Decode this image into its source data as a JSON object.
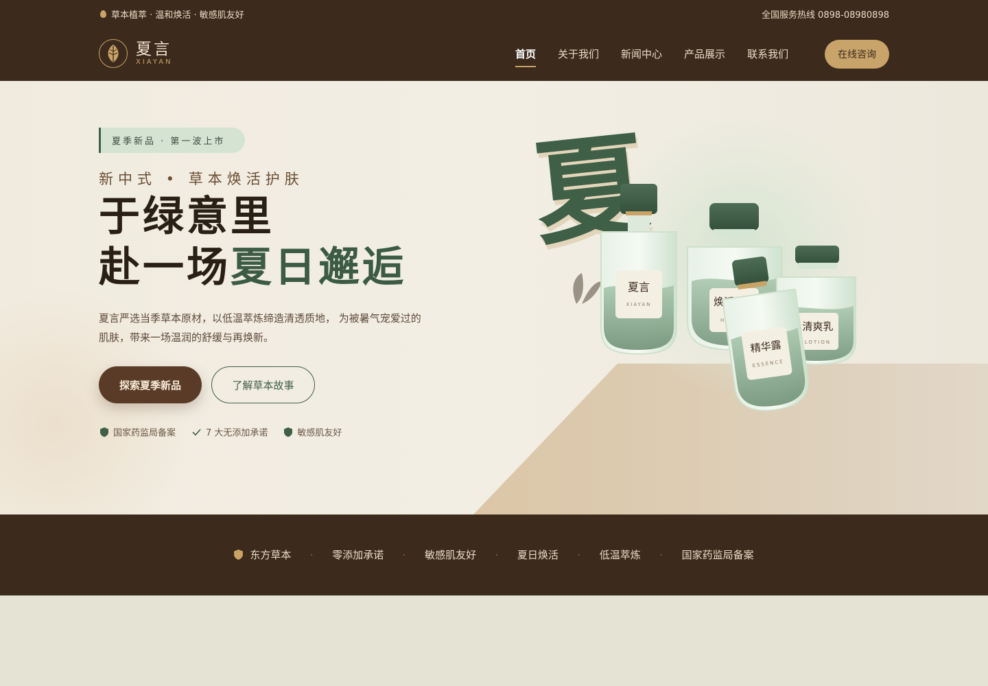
{
  "topbar": {
    "tagline": "草本植萃 · 温和焕活 · 敏感肌友好",
    "hotline_label": "全国服务热线",
    "hotline_number": "0898-08980898"
  },
  "brand": {
    "name_cn": "夏言",
    "name_en": "XIAYAN"
  },
  "nav": {
    "items": [
      "首页",
      "关于我们",
      "新闻中心",
      "产品展示",
      "联系我们"
    ],
    "active": "首页",
    "cta": "在线咨询"
  },
  "hero": {
    "badge": "夏季新品  ·  第一波上市",
    "kicker": "新中式  •  草本焕活护肤",
    "headline_line1": "于绿意里",
    "headline_line2_a": "赴一场",
    "headline_line2_b": "夏日邂逅",
    "description": "夏言严选当季草本原材，以低温萃炼缔造清透质地， 为被暑气宠爱过的肌肤，带来一场温润的舒缓与再焕新。",
    "primary_button": "探索夏季新品",
    "secondary_button": "了解草本故事",
    "trust_items": [
      "国家药监局备案",
      "7 大无添加承诺",
      "敏感肌友好"
    ],
    "calligraphy": "夏",
    "products": {
      "bottle1_cn": "夏言",
      "bottle1_en": "XIAYAN",
      "jar_cn": "焕活面霜",
      "jar_en": "HERBAL",
      "bottle3_cn": "清爽乳",
      "bottle3_en": "LOTION",
      "tube_cn": "精华露",
      "tube_en": "ESSENCE"
    }
  },
  "strip": {
    "items": [
      "东方草本",
      "零添加承诺",
      "敏感肌友好",
      "夏日焕活",
      "低温萃炼",
      "国家药监局备案"
    ]
  },
  "colors": {
    "dark_brown": "#3c2a1d",
    "gold": "#c9a466",
    "herbal_green": "#3f5f47",
    "cream": "#f2eee4"
  }
}
